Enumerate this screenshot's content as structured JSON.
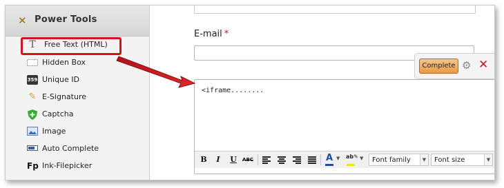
{
  "sidebar": {
    "title": "Power Tools",
    "items": [
      {
        "label": "Free Text (HTML)",
        "icon": "text-T-icon"
      },
      {
        "label": "Hidden Box",
        "icon": "hidden-box-icon"
      },
      {
        "label": "Unique ID",
        "icon": "unique-id-icon"
      },
      {
        "label": "E-Signature",
        "icon": "pen-icon"
      },
      {
        "label": "Captcha",
        "icon": "shield-icon"
      },
      {
        "label": "Image",
        "icon": "image-icon"
      },
      {
        "label": "Auto Complete",
        "icon": "auto-complete-icon"
      },
      {
        "label": "Ink-Filepicker",
        "icon": "fp-icon"
      }
    ]
  },
  "form": {
    "email_label": "E-mail",
    "required_mark": "*",
    "editor_content": "<iframe........",
    "complete_label": "Complete",
    "font_family": "Font family",
    "font_size": "Font size"
  },
  "icons": {
    "unique_id_glyph": "359",
    "fp_glyph": "Fp"
  },
  "colors": {
    "highlight": "#d0141a",
    "complete_button": "#e79a48",
    "font_color": "#1f4d9a",
    "bg_color": "#f2e21c"
  }
}
